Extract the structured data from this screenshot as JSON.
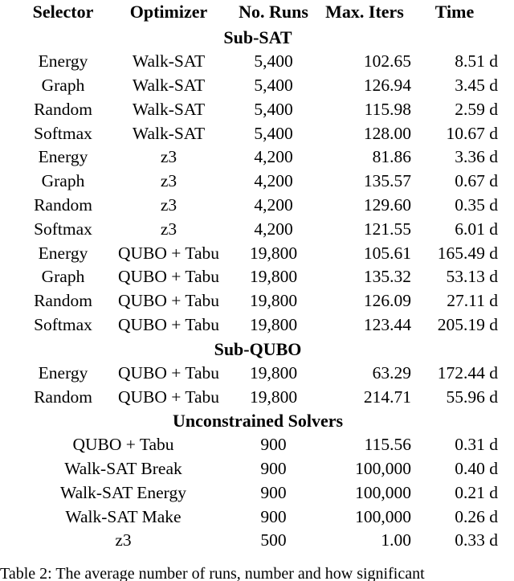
{
  "table": {
    "columns": [
      "Selector",
      "Optimizer",
      "No. Runs",
      "Max. Iters",
      "Time"
    ],
    "sections": [
      {
        "title": "Sub-SAT",
        "groups": [
          {
            "rows": [
              {
                "selector": "Energy",
                "optimizer": "Walk-SAT",
                "runs": "5,400",
                "iters": "102.65",
                "time": "8.51 d"
              },
              {
                "selector": "Graph",
                "optimizer": "Walk-SAT",
                "runs": "5,400",
                "iters": "126.94",
                "time": "3.45 d"
              },
              {
                "selector": "Random",
                "optimizer": "Walk-SAT",
                "runs": "5,400",
                "iters": "115.98",
                "time": "2.59 d"
              },
              {
                "selector": "Softmax",
                "optimizer": "Walk-SAT",
                "runs": "5,400",
                "iters": "128.00",
                "time": "10.67 d"
              }
            ]
          },
          {
            "rows": [
              {
                "selector": "Energy",
                "optimizer": "z3",
                "runs": "4,200",
                "iters": "81.86",
                "time": "3.36 d"
              },
              {
                "selector": "Graph",
                "optimizer": "z3",
                "runs": "4,200",
                "iters": "135.57",
                "time": "0.67 d"
              },
              {
                "selector": "Random",
                "optimizer": "z3",
                "runs": "4,200",
                "iters": "129.60",
                "time": "0.35 d"
              },
              {
                "selector": "Softmax",
                "optimizer": "z3",
                "runs": "4,200",
                "iters": "121.55",
                "time": "6.01 d"
              }
            ]
          },
          {
            "rows": [
              {
                "selector": "Energy",
                "optimizer": "QUBO + Tabu",
                "runs": "19,800",
                "iters": "105.61",
                "time": "165.49 d"
              },
              {
                "selector": "Graph",
                "optimizer": "QUBO + Tabu",
                "runs": "19,800",
                "iters": "135.32",
                "time": "53.13 d"
              },
              {
                "selector": "Random",
                "optimizer": "QUBO + Tabu",
                "runs": "19,800",
                "iters": "126.09",
                "time": "27.11 d"
              },
              {
                "selector": "Softmax",
                "optimizer": "QUBO + Tabu",
                "runs": "19,800",
                "iters": "123.44",
                "time": "205.19 d"
              }
            ]
          }
        ]
      },
      {
        "title": "Sub-QUBO",
        "groups": [
          {
            "rows": [
              {
                "selector": "Energy",
                "optimizer": "QUBO + Tabu",
                "runs": "19,800",
                "iters": "63.29",
                "time": "172.44 d"
              },
              {
                "selector": "Random",
                "optimizer": "QUBO + Tabu",
                "runs": "19,800",
                "iters": "214.71",
                "time": "55.96 d"
              }
            ]
          }
        ]
      },
      {
        "title": "Unconstrained Solvers",
        "groups": [
          {
            "rows": [
              {
                "solver": "QUBO + Tabu",
                "runs": "900",
                "iters": "115.56",
                "time": "0.31 d"
              },
              {
                "solver": "Walk-SAT Break",
                "runs": "900",
                "iters": "100,000",
                "time": "0.40 d"
              },
              {
                "solver": "Walk-SAT Energy",
                "runs": "900",
                "iters": "100,000",
                "time": "0.21 d"
              },
              {
                "solver": "Walk-SAT Make",
                "runs": "900",
                "iters": "100,000",
                "time": "0.26 d"
              },
              {
                "solver": "z3",
                "runs": "500",
                "iters": "1.00",
                "time": "0.33 d"
              }
            ]
          }
        ]
      }
    ]
  },
  "caption": {
    "text": "Table 2:  The  average  number  of  runs,  number  and  how  significant"
  }
}
